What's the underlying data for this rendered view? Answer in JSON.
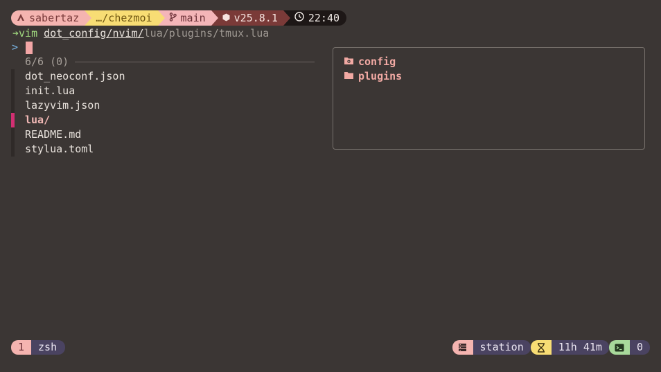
{
  "prompt": {
    "user": "sabertaz",
    "path": "…/chezmoi",
    "branch": "main",
    "node_version": "v25.8.1",
    "time": "22:40",
    "icons": [
      "arch-icon",
      "branch-icon",
      "node-icon",
      "clock-icon"
    ]
  },
  "command": {
    "arrow": "➔",
    "program": "vim",
    "path_typed": "dot_config/nvim/",
    "path_suggestion": "lua/plugins/tmux.lua"
  },
  "fzf": {
    "prompt_symbol": ">",
    "query": "",
    "counter": "6/6 (0)",
    "items": [
      "dot_neoconf.json",
      "init.lua",
      "lazyvim.json",
      "lua/",
      "README.md",
      "stylua.toml"
    ],
    "selected_index": 3
  },
  "preview": {
    "items": [
      {
        "label": "config",
        "icon": "folder-gear-icon"
      },
      {
        "label": "plugins",
        "icon": "folder-icon"
      }
    ]
  },
  "tmux": {
    "window_index": "1",
    "window_name": "zsh",
    "host": "station",
    "uptime": "11h 41m",
    "pane_count": "0"
  },
  "colors": {
    "background": "#3b3634",
    "accent_pink": "#f5b4b0",
    "accent_yellow": "#f8dd74",
    "selection_bar": "#d22f72",
    "command_green": "#9fd77e"
  }
}
